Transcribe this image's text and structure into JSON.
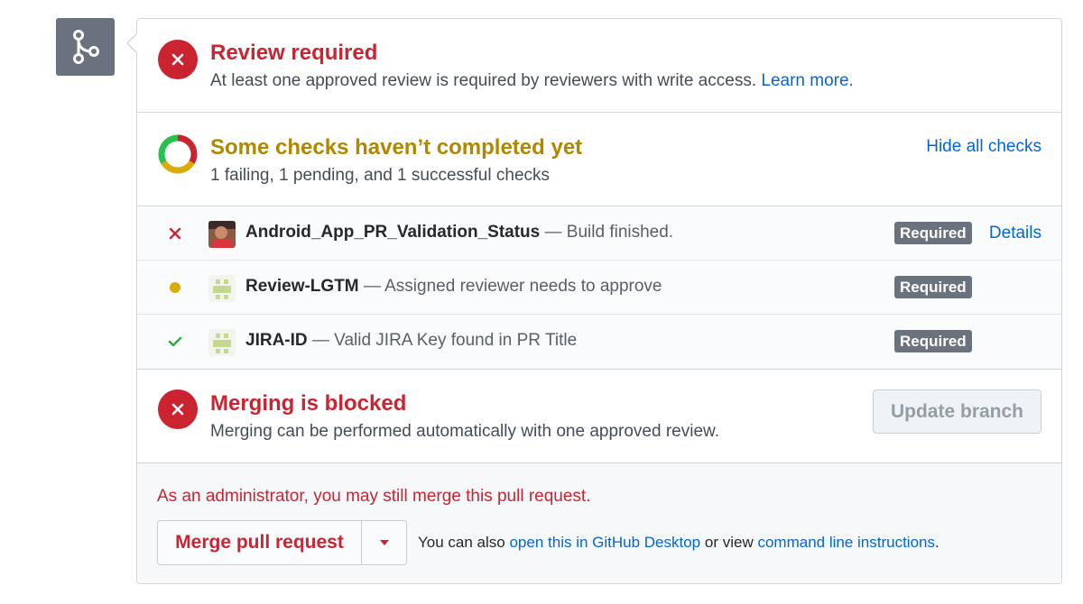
{
  "review": {
    "title": "Review required",
    "description": "At least one approved review is required by reviewers with write access.",
    "learn_more": "Learn more."
  },
  "checks": {
    "title": "Some checks haven’t completed yet",
    "summary": "1 failing, 1 pending, and 1 successful checks",
    "hide_label": "Hide all checks",
    "items": [
      {
        "status": "failing",
        "name": "Android_App_PR_Validation_Status",
        "description": "— Build finished.",
        "badge": "Required",
        "details": "Details"
      },
      {
        "status": "pending",
        "name": "Review-LGTM",
        "description": "— Assigned reviewer needs to approve",
        "badge": "Required"
      },
      {
        "status": "success",
        "name": "JIRA-ID",
        "description": "— Valid JIRA Key found in PR Title",
        "badge": "Required"
      }
    ]
  },
  "merge": {
    "title": "Merging is blocked",
    "description": "Merging can be performed automatically with one approved review.",
    "update_branch": "Update branch"
  },
  "admin": {
    "note": "As an administrator, you may still merge this pull request.",
    "merge_button": "Merge pull request",
    "hint_prefix": "You can also",
    "desktop_link": "open this in GitHub Desktop",
    "hint_middle": "or view",
    "cli_link": "command line instructions",
    "hint_suffix": "."
  },
  "colors": {
    "error": "#cb2431",
    "pending": "#dbab09",
    "success": "#28a745",
    "link": "#0366d6",
    "badge": "#6a737d"
  },
  "icons": [
    "git-merge-icon",
    "x-icon",
    "checks-donut-icon",
    "dot-icon",
    "check-icon",
    "triangle-down-icon"
  ]
}
